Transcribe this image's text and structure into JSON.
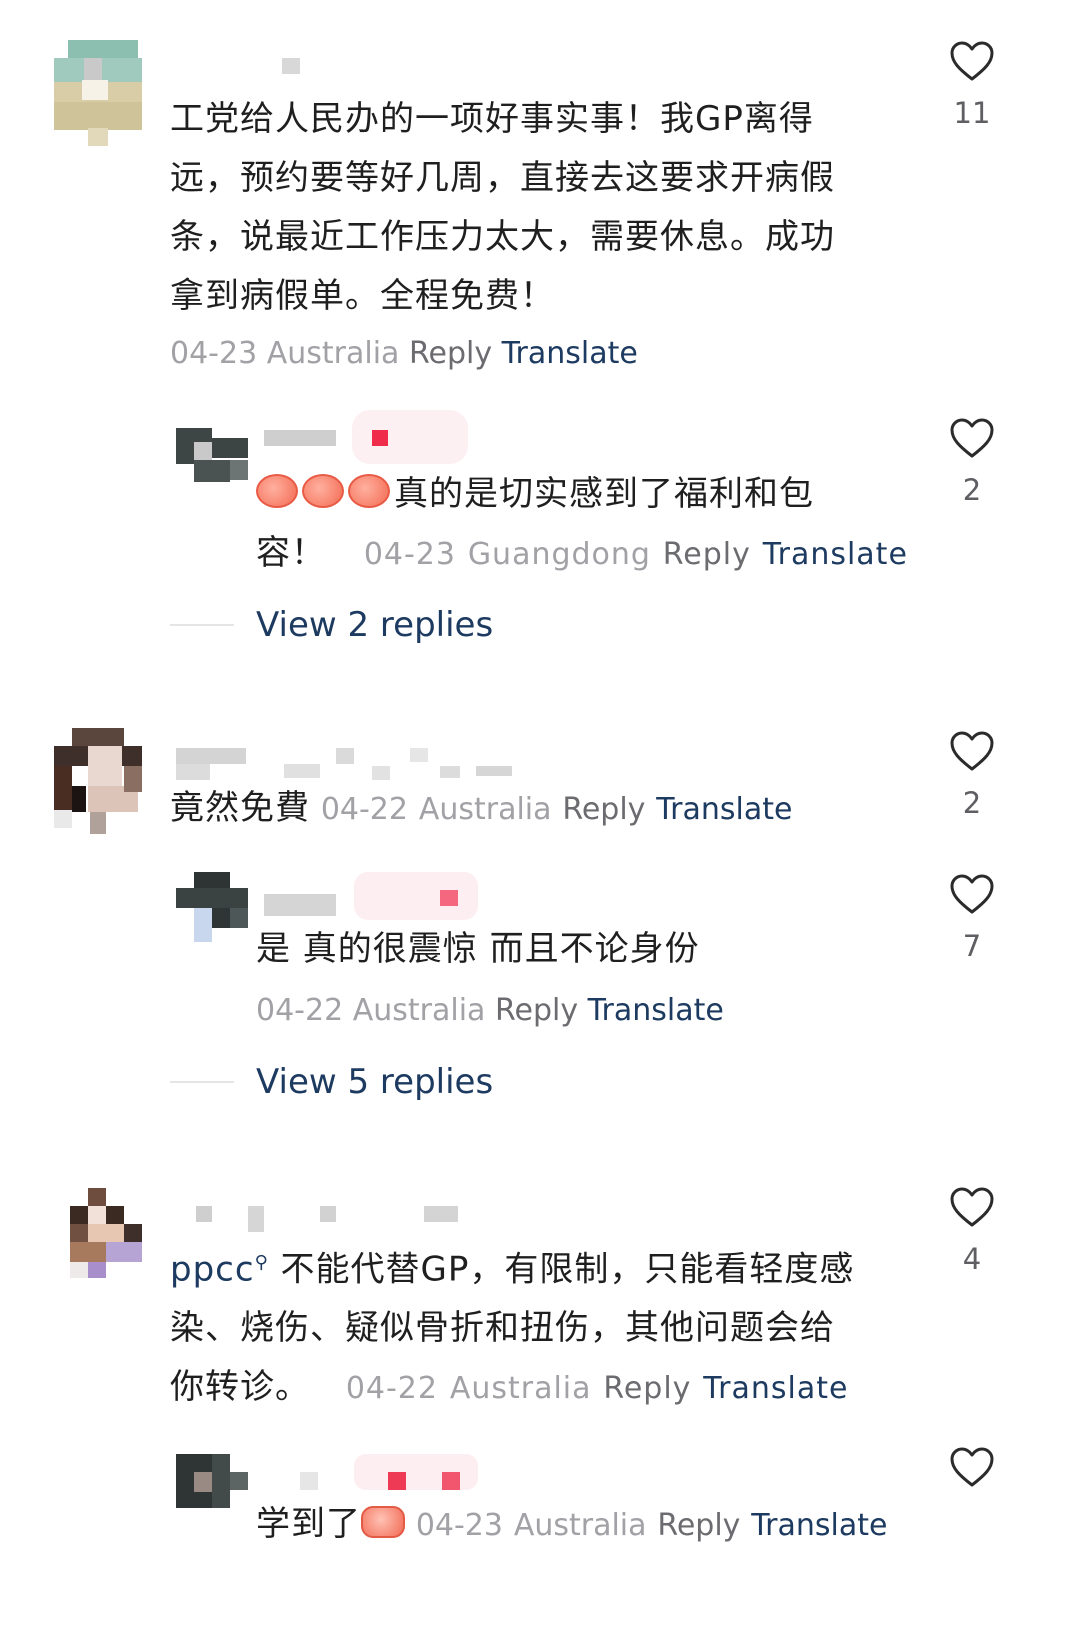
{
  "comments": [
    {
      "text_lines": [
        "工党给人民办的一项好事实事！我GP离得",
        "远，预约要等好几周，直接去这要求开病假",
        "条，说最近工作压力太大，需要休息。成功",
        "拿到病假单。全程免费！"
      ],
      "date": "04-23",
      "location": "Australia",
      "reply_label": "Reply",
      "translate_label": "Translate",
      "likes": "11"
    },
    {
      "text_line1": "真的是切实感到了福利和包",
      "text_line2": "容！",
      "date": "04-23",
      "location": "Guangdong",
      "reply_label": "Reply",
      "translate_label": "Translate",
      "likes": "2",
      "emoji": "peach-emoji"
    },
    {
      "view_replies": "View 2 replies"
    },
    {
      "text": "竟然免費",
      "date": "04-22",
      "location": "Australia",
      "reply_label": "Reply",
      "translate_label": "Translate",
      "likes": "2"
    },
    {
      "text": "是 真的很震惊 而且不论身份",
      "date": "04-22",
      "location": "Australia",
      "reply_label": "Reply",
      "translate_label": "Translate",
      "likes": "7"
    },
    {
      "view_replies": "View 5 replies"
    },
    {
      "mention": "ppcc",
      "text_line1": " 不能代替GP，有限制，只能看轻度感",
      "text_line2": "染、烧伤、疑似骨折和扭伤，其他问题会给",
      "text_line3": "你转诊。",
      "date": "04-22",
      "location": "Australia",
      "reply_label": "Reply",
      "translate_label": "Translate",
      "likes": "4"
    },
    {
      "text": "学到了",
      "date": "04-23",
      "location": "Australia",
      "reply_label": "Reply",
      "translate_label": "Translate",
      "emoji": "clapping-hands-emoji"
    }
  ],
  "colors": {
    "link": "#1d3a60",
    "meta": "#a1a1a6",
    "text": "#1f1f1f",
    "divider": "#e5e5e5"
  },
  "icons": {
    "like": "heart-outline-icon",
    "mention": "search-icon"
  }
}
